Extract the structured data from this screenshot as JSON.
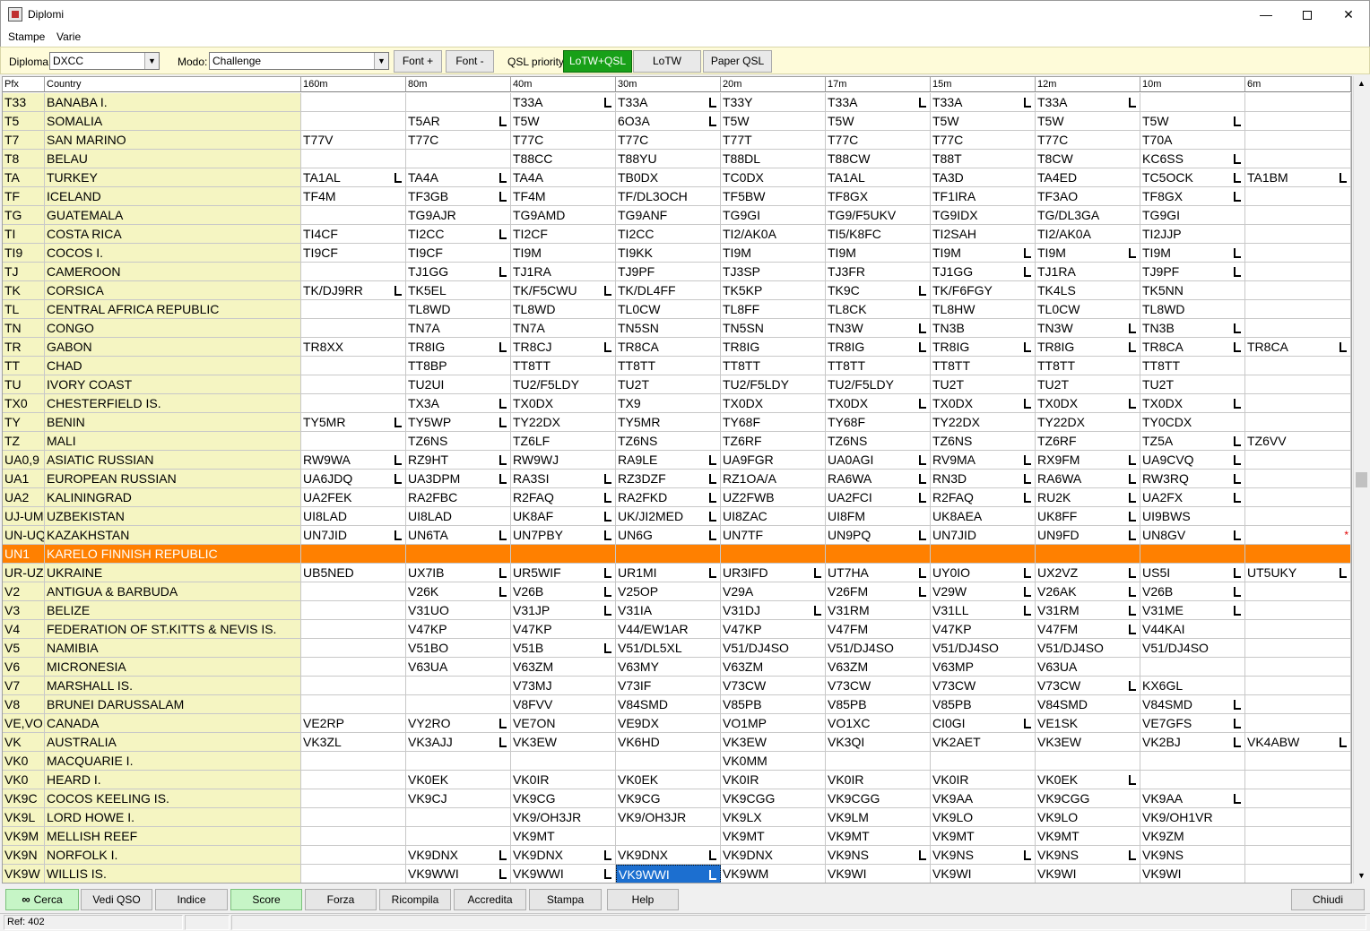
{
  "window": {
    "title": "Diplomi",
    "minimize": "—",
    "close": "✕"
  },
  "menu": [
    "Stampe",
    "Varie"
  ],
  "toolbar": {
    "diploma_label": "Diploma:",
    "diploma_value": "DXCC",
    "modo_label": "Modo:",
    "modo_value": "Challenge",
    "font_plus": "Font +",
    "font_minus": "Font -",
    "qsl_label": "QSL priority:",
    "qsl_buttons": [
      "LoTW+QSL",
      "LoTW",
      "Paper QSL"
    ],
    "qsl_active": "LoTW+QSL"
  },
  "grid": {
    "headers": [
      "Pfx",
      "Country",
      "160m",
      "80m",
      "40m",
      "30m",
      "20m",
      "17m",
      "15m",
      "12m",
      "10m",
      "6m"
    ],
    "rows": [
      {
        "pfx": "T33",
        "country": "BANABA I.",
        "bands": [
          "",
          "",
          "T33A",
          "T33A",
          "T33Y",
          "T33A",
          "T33A",
          "T33A",
          "",
          ""
        ],
        "lotw": [
          0,
          0,
          1,
          1,
          0,
          1,
          1,
          1,
          0,
          0
        ]
      },
      {
        "pfx": "T5",
        "country": "SOMALIA",
        "bands": [
          "",
          "T5AR",
          "T5W",
          "6O3A",
          "T5W",
          "T5W",
          "T5W",
          "T5W",
          "T5W",
          ""
        ],
        "lotw": [
          0,
          1,
          0,
          1,
          0,
          0,
          0,
          0,
          1,
          0
        ]
      },
      {
        "pfx": "T7",
        "country": "SAN MARINO",
        "bands": [
          "T77V",
          "T77C",
          "T77C",
          "T77C",
          "T77T",
          "T77C",
          "T77C",
          "T77C",
          "T70A",
          ""
        ],
        "lotw": [
          0,
          0,
          0,
          0,
          0,
          0,
          0,
          0,
          0,
          0
        ]
      },
      {
        "pfx": "T8",
        "country": "BELAU",
        "bands": [
          "",
          "",
          "T88CC",
          "T88YU",
          "T88DL",
          "T88CW",
          "T88T",
          "T8CW",
          "KC6SS",
          ""
        ],
        "lotw": [
          0,
          0,
          0,
          0,
          0,
          0,
          0,
          0,
          1,
          0
        ]
      },
      {
        "pfx": "TA",
        "country": "TURKEY",
        "bands": [
          "TA1AL",
          "TA4A",
          "TA4A",
          "TB0DX",
          "TC0DX",
          "TA1AL",
          "TA3D",
          "TA4ED",
          "TC5OCK",
          "TA1BM"
        ],
        "lotw": [
          1,
          1,
          0,
          0,
          0,
          0,
          0,
          0,
          1,
          1
        ]
      },
      {
        "pfx": "TF",
        "country": "ICELAND",
        "bands": [
          "TF4M",
          "TF3GB",
          "TF4M",
          "TF/DL3OCH",
          "TF5BW",
          "TF8GX",
          "TF1IRA",
          "TF3AO",
          "TF8GX",
          ""
        ],
        "lotw": [
          0,
          1,
          0,
          0,
          0,
          0,
          0,
          0,
          1,
          0
        ]
      },
      {
        "pfx": "TG",
        "country": "GUATEMALA",
        "bands": [
          "",
          "TG9AJR",
          "TG9AMD",
          "TG9ANF",
          "TG9GI",
          "TG9/F5UKV",
          "TG9IDX",
          "TG/DL3GA",
          "TG9GI",
          ""
        ],
        "lotw": [
          0,
          0,
          0,
          0,
          0,
          0,
          0,
          0,
          0,
          0
        ]
      },
      {
        "pfx": "TI",
        "country": "COSTA RICA",
        "bands": [
          "TI4CF",
          "TI2CC",
          "TI2CF",
          "TI2CC",
          "TI2/AK0A",
          "TI5/K8FC",
          "TI2SAH",
          "TI2/AK0A",
          "TI2JJP",
          ""
        ],
        "lotw": [
          0,
          1,
          0,
          0,
          0,
          0,
          0,
          0,
          0,
          0
        ]
      },
      {
        "pfx": "TI9",
        "country": "COCOS I.",
        "bands": [
          "TI9CF",
          "TI9CF",
          "TI9M",
          "TI9KK",
          "TI9M",
          "TI9M",
          "TI9M",
          "TI9M",
          "TI9M",
          ""
        ],
        "lotw": [
          0,
          0,
          0,
          0,
          0,
          0,
          1,
          1,
          1,
          0
        ]
      },
      {
        "pfx": "TJ",
        "country": "CAMEROON",
        "bands": [
          "",
          "TJ1GG",
          "TJ1RA",
          "TJ9PF",
          "TJ3SP",
          "TJ3FR",
          "TJ1GG",
          "TJ1RA",
          "TJ9PF",
          ""
        ],
        "lotw": [
          0,
          1,
          0,
          0,
          0,
          0,
          1,
          0,
          1,
          0
        ]
      },
      {
        "pfx": "TK",
        "country": "CORSICA",
        "bands": [
          "TK/DJ9RR",
          "TK5EL",
          "TK/F5CWU",
          "TK/DL4FF",
          "TK5KP",
          "TK9C",
          "TK/F6FGY",
          "TK4LS",
          "TK5NN",
          ""
        ],
        "lotw": [
          1,
          0,
          1,
          0,
          0,
          1,
          0,
          0,
          0,
          0
        ]
      },
      {
        "pfx": "TL",
        "country": "CENTRAL AFRICA REPUBLIC",
        "bands": [
          "",
          "TL8WD",
          "TL8WD",
          "TL0CW",
          "TL8FF",
          "TL8CK",
          "TL8HW",
          "TL0CW",
          "TL8WD",
          ""
        ],
        "lotw": [
          0,
          0,
          0,
          0,
          0,
          0,
          0,
          0,
          0,
          0
        ]
      },
      {
        "pfx": "TN",
        "country": "CONGO",
        "bands": [
          "",
          "TN7A",
          "TN7A",
          "TN5SN",
          "TN5SN",
          "TN3W",
          "TN3B",
          "TN3W",
          "TN3B",
          ""
        ],
        "lotw": [
          0,
          0,
          0,
          0,
          0,
          1,
          0,
          1,
          1,
          0
        ]
      },
      {
        "pfx": "TR",
        "country": "GABON",
        "bands": [
          "TR8XX",
          "TR8IG",
          "TR8CJ",
          "TR8CA",
          "TR8IG",
          "TR8IG",
          "TR8IG",
          "TR8IG",
          "TR8CA",
          "TR8CA"
        ],
        "lotw": [
          0,
          1,
          1,
          0,
          0,
          1,
          1,
          1,
          1,
          1
        ]
      },
      {
        "pfx": "TT",
        "country": "CHAD",
        "bands": [
          "",
          "TT8BP",
          "TT8TT",
          "TT8TT",
          "TT8TT",
          "TT8TT",
          "TT8TT",
          "TT8TT",
          "TT8TT",
          ""
        ],
        "lotw": [
          0,
          0,
          0,
          0,
          0,
          0,
          0,
          0,
          0,
          0
        ]
      },
      {
        "pfx": "TU",
        "country": "IVORY COAST",
        "bands": [
          "",
          "TU2UI",
          "TU2/F5LDY",
          "TU2T",
          "TU2/F5LDY",
          "TU2/F5LDY",
          "TU2T",
          "TU2T",
          "TU2T",
          ""
        ],
        "lotw": [
          0,
          0,
          0,
          0,
          0,
          0,
          0,
          0,
          0,
          0
        ]
      },
      {
        "pfx": "TX0",
        "country": "CHESTERFIELD IS.",
        "bands": [
          "",
          "TX3A",
          "TX0DX",
          "TX9",
          "TX0DX",
          "TX0DX",
          "TX0DX",
          "TX0DX",
          "TX0DX",
          ""
        ],
        "lotw": [
          0,
          1,
          0,
          0,
          0,
          1,
          1,
          1,
          1,
          0
        ]
      },
      {
        "pfx": "TY",
        "country": "BENIN",
        "bands": [
          "TY5MR",
          "TY5WP",
          "TY22DX",
          "TY5MR",
          "TY68F",
          "TY68F",
          "TY22DX",
          "TY22DX",
          "TY0CDX",
          ""
        ],
        "lotw": [
          1,
          1,
          0,
          0,
          0,
          0,
          0,
          0,
          0,
          0
        ]
      },
      {
        "pfx": "TZ",
        "country": "MALI",
        "bands": [
          "",
          "TZ6NS",
          "TZ6LF",
          "TZ6NS",
          "TZ6RF",
          "TZ6NS",
          "TZ6NS",
          "TZ6RF",
          "TZ5A",
          "TZ6VV"
        ],
        "lotw": [
          0,
          0,
          0,
          0,
          0,
          0,
          0,
          0,
          1,
          0
        ]
      },
      {
        "pfx": "UA0,9",
        "country": "ASIATIC RUSSIAN",
        "bands": [
          "RW9WA",
          "RZ9HT",
          "RW9WJ",
          "RA9LE",
          "UA9FGR",
          "UA0AGI",
          "RV9MA",
          "RX9FM",
          "UA9CVQ",
          ""
        ],
        "lotw": [
          1,
          1,
          0,
          1,
          0,
          1,
          1,
          1,
          1,
          0
        ]
      },
      {
        "pfx": "UA1",
        "country": "EUROPEAN RUSSIAN",
        "bands": [
          "UA6JDQ",
          "UA3DPM",
          "RA3SI",
          "RZ3DZF",
          "RZ1OA/A",
          "RA6WA",
          "RN3D",
          "RA6WA",
          "RW3RQ",
          ""
        ],
        "lotw": [
          1,
          1,
          1,
          1,
          0,
          1,
          1,
          1,
          1,
          0
        ]
      },
      {
        "pfx": "UA2",
        "country": "KALININGRAD",
        "bands": [
          "UA2FEK",
          "RA2FBC",
          "R2FAQ",
          "RA2FKD",
          "UZ2FWB",
          "UA2FCI",
          "R2FAQ",
          "RU2K",
          "UA2FX",
          ""
        ],
        "lotw": [
          0,
          0,
          1,
          1,
          0,
          1,
          1,
          1,
          1,
          0
        ]
      },
      {
        "pfx": "UJ-UM",
        "country": "UZBEKISTAN",
        "bands": [
          "UI8LAD",
          "UI8LAD",
          "UK8AF",
          "UK/JI2MED",
          "UI8ZAC",
          "UI8FM",
          "UK8AEA",
          "UK8FF",
          "UI9BWS",
          ""
        ],
        "lotw": [
          0,
          0,
          1,
          1,
          0,
          0,
          0,
          1,
          0,
          0
        ]
      },
      {
        "pfx": "UN-UQ",
        "country": "KAZAKHSTAN",
        "bands": [
          "UN7JID",
          "UN6TA",
          "UN7PBY",
          "UN6G",
          "UN7TF",
          "UN9PQ",
          "UN7JID",
          "UN9FD",
          "UN8GV",
          ""
        ],
        "lotw": [
          1,
          1,
          1,
          1,
          0,
          1,
          0,
          1,
          1,
          0
        ],
        "star": "*"
      },
      {
        "pfx": "UN1",
        "country": "KARELO FINNISH REPUBLIC",
        "bands": [
          "",
          "",
          "",
          "",
          "",
          "",
          "",
          "",
          "",
          ""
        ],
        "lotw": [
          0,
          0,
          0,
          0,
          0,
          0,
          0,
          0,
          0,
          0
        ],
        "highlight": true
      },
      {
        "pfx": "UR-UZ",
        "country": "UKRAINE",
        "bands": [
          "UB5NED",
          "UX7IB",
          "UR5WIF",
          "UR1MI",
          "UR3IFD",
          "UT7HA",
          "UY0IO",
          "UX2VZ",
          "US5I",
          "UT5UKY"
        ],
        "lotw": [
          0,
          1,
          1,
          1,
          1,
          1,
          1,
          1,
          1,
          1
        ]
      },
      {
        "pfx": "V2",
        "country": "ANTIGUA & BARBUDA",
        "bands": [
          "",
          "V26K",
          "V26B",
          "V25OP",
          "V29A",
          "V26FM",
          "V29W",
          "V26AK",
          "V26B",
          ""
        ],
        "lotw": [
          0,
          1,
          1,
          0,
          0,
          1,
          1,
          1,
          1,
          0
        ]
      },
      {
        "pfx": "V3",
        "country": "BELIZE",
        "bands": [
          "",
          "V31UO",
          "V31JP",
          "V31IA",
          "V31DJ",
          "V31RM",
          "V31LL",
          "V31RM",
          "V31ME",
          ""
        ],
        "lotw": [
          0,
          0,
          1,
          0,
          1,
          0,
          1,
          1,
          1,
          0
        ]
      },
      {
        "pfx": "V4",
        "country": "FEDERATION OF ST.KITTS & NEVIS IS.",
        "bands": [
          "",
          "V47KP",
          "V47KP",
          "V44/EW1AR",
          "V47KP",
          "V47FM",
          "V47KP",
          "V47FM",
          "V44KAI",
          ""
        ],
        "lotw": [
          0,
          0,
          0,
          0,
          0,
          0,
          0,
          1,
          0,
          0
        ]
      },
      {
        "pfx": "V5",
        "country": "NAMIBIA",
        "bands": [
          "",
          "V51BO",
          "V51B",
          "V51/DL5XL",
          "V51/DJ4SO",
          "V51/DJ4SO",
          "V51/DJ4SO",
          "V51/DJ4SO",
          "V51/DJ4SO",
          ""
        ],
        "lotw": [
          0,
          0,
          1,
          0,
          0,
          0,
          0,
          0,
          0,
          0
        ]
      },
      {
        "pfx": "V6",
        "country": "MICRONESIA",
        "bands": [
          "",
          "V63UA",
          "V63ZM",
          "V63MY",
          "V63ZM",
          "V63ZM",
          "V63MP",
          "V63UA",
          "",
          ""
        ],
        "lotw": [
          0,
          0,
          0,
          0,
          0,
          0,
          0,
          0,
          0,
          0
        ]
      },
      {
        "pfx": "V7",
        "country": "MARSHALL IS.",
        "bands": [
          "",
          "",
          "V73MJ",
          "V73IF",
          "V73CW",
          "V73CW",
          "V73CW",
          "V73CW",
          "KX6GL",
          ""
        ],
        "lotw": [
          0,
          0,
          0,
          0,
          0,
          0,
          0,
          1,
          0,
          0
        ]
      },
      {
        "pfx": "V8",
        "country": "BRUNEI DARUSSALAM",
        "bands": [
          "",
          "",
          "V8FVV",
          "V84SMD",
          "V85PB",
          "V85PB",
          "V85PB",
          "V84SMD",
          "V84SMD",
          ""
        ],
        "lotw": [
          0,
          0,
          0,
          0,
          0,
          0,
          0,
          0,
          1,
          0
        ]
      },
      {
        "pfx": "VE,VO",
        "country": "CANADA",
        "bands": [
          "VE2RP",
          "VY2RO",
          "VE7ON",
          "VE9DX",
          "VO1MP",
          "VO1XC",
          "CI0GI",
          "VE1SK",
          "VE7GFS",
          ""
        ],
        "lotw": [
          0,
          1,
          0,
          0,
          0,
          0,
          1,
          0,
          1,
          0
        ]
      },
      {
        "pfx": "VK",
        "country": "AUSTRALIA",
        "bands": [
          "VK3ZL",
          "VK3AJJ",
          "VK3EW",
          "VK6HD",
          "VK3EW",
          "VK3QI",
          "VK2AET",
          "VK3EW",
          "VK2BJ",
          "VK4ABW"
        ],
        "lotw": [
          0,
          1,
          0,
          0,
          0,
          0,
          0,
          0,
          1,
          1
        ]
      },
      {
        "pfx": "VK0",
        "country": "MACQUARIE I.",
        "bands": [
          "",
          "",
          "",
          "",
          "VK0MM",
          "",
          "",
          "",
          "",
          ""
        ],
        "lotw": [
          0,
          0,
          0,
          0,
          0,
          0,
          0,
          0,
          0,
          0
        ]
      },
      {
        "pfx": "VK0",
        "country": "HEARD I.",
        "bands": [
          "",
          "VK0EK",
          "VK0IR",
          "VK0EK",
          "VK0IR",
          "VK0IR",
          "VK0IR",
          "VK0EK",
          "",
          ""
        ],
        "lotw": [
          0,
          0,
          0,
          0,
          0,
          0,
          0,
          1,
          0,
          0
        ]
      },
      {
        "pfx": "VK9C",
        "country": "COCOS KEELING IS.",
        "bands": [
          "",
          "VK9CJ",
          "VK9CG",
          "VK9CG",
          "VK9CGG",
          "VK9CGG",
          "VK9AA",
          "VK9CGG",
          "VK9AA",
          ""
        ],
        "lotw": [
          0,
          0,
          0,
          0,
          0,
          0,
          0,
          0,
          1,
          0
        ]
      },
      {
        "pfx": "VK9L",
        "country": "LORD HOWE I.",
        "bands": [
          "",
          "",
          "VK9/OH3JR",
          "VK9/OH3JR",
          "VK9LX",
          "VK9LM",
          "VK9LO",
          "VK9LO",
          "VK9/OH1VR",
          ""
        ],
        "lotw": [
          0,
          0,
          0,
          0,
          0,
          0,
          0,
          0,
          0,
          0
        ]
      },
      {
        "pfx": "VK9M",
        "country": "MELLISH REEF",
        "bands": [
          "",
          "",
          "VK9MT",
          "",
          "VK9MT",
          "VK9MT",
          "VK9MT",
          "VK9MT",
          "VK9ZM",
          ""
        ],
        "lotw": [
          0,
          0,
          0,
          0,
          0,
          0,
          0,
          0,
          0,
          0
        ]
      },
      {
        "pfx": "VK9N",
        "country": "NORFOLK I.",
        "bands": [
          "",
          "VK9DNX",
          "VK9DNX",
          "VK9DNX",
          "VK9DNX",
          "VK9NS",
          "VK9NS",
          "VK9NS",
          "VK9NS",
          ""
        ],
        "lotw": [
          0,
          1,
          1,
          1,
          0,
          1,
          1,
          1,
          0,
          0
        ]
      },
      {
        "pfx": "VK9W",
        "country": "WILLIS IS.",
        "bands": [
          "",
          "VK9WWI",
          "VK9WWI",
          "VK9WWI",
          "VK9WM",
          "VK9WI",
          "VK9WI",
          "VK9WI",
          "VK9WI",
          ""
        ],
        "lotw": [
          0,
          1,
          1,
          1,
          0,
          0,
          0,
          0,
          0,
          0
        ],
        "selected_band": 3
      }
    ]
  },
  "buttons": {
    "cerca": "Cerca",
    "vedi_qso": "Vedi QSO",
    "indice": "Indice",
    "score": "Score",
    "forza": "Forza",
    "ricompila": "Ricompila",
    "accredita": "Accredita",
    "stampa": "Stampa",
    "help": "Help",
    "chiudi": "Chiudi"
  },
  "status": {
    "ref": "Ref: 402"
  },
  "colors": {
    "country_bg": "#f5f5c2",
    "highlight_row": "#ff8000",
    "selected_cell": "#1c6fd0",
    "active_qsl": "#18a018",
    "toolbar_bg": "#fefbd9"
  }
}
